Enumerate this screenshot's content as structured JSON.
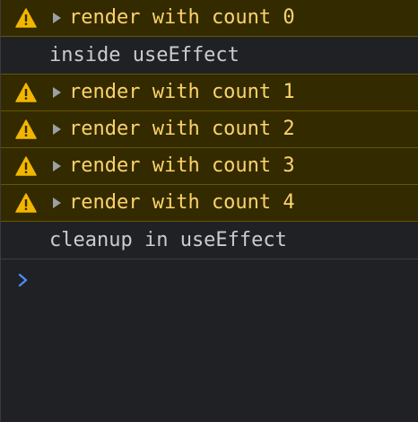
{
  "console": {
    "messages": [
      {
        "level": "warning",
        "text": "render with count 0",
        "expandable": true,
        "icon": "warning-icon"
      },
      {
        "level": "log",
        "text": "inside useEffect",
        "expandable": false
      },
      {
        "level": "warning",
        "text": "render with count 1",
        "expandable": true,
        "icon": "warning-icon"
      },
      {
        "level": "warning",
        "text": "render with count 2",
        "expandable": true,
        "icon": "warning-icon"
      },
      {
        "level": "warning",
        "text": "render with count 3",
        "expandable": true,
        "icon": "warning-icon"
      },
      {
        "level": "warning",
        "text": "render with count 4",
        "expandable": true,
        "icon": "warning-icon"
      },
      {
        "level": "log",
        "text": "cleanup in useEffect",
        "expandable": false
      }
    ],
    "prompt_icon": "chevron-right-icon"
  },
  "colors": {
    "background": "#202124",
    "warning_background": "#332a00",
    "warning_text": "#fcd36a",
    "log_text": "#c9ccd1",
    "prompt": "#4d8af0"
  }
}
